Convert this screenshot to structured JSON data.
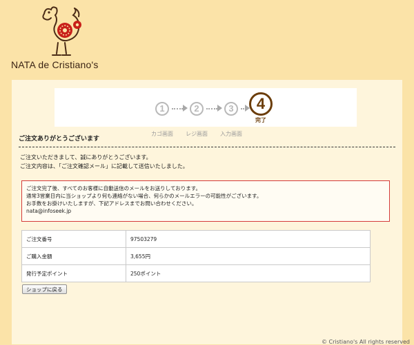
{
  "brand": {
    "name": "NATA de Cristiano's"
  },
  "steps": [
    {
      "num": "1",
      "label": "カゴ画面"
    },
    {
      "num": "2",
      "label": "レジ画面"
    },
    {
      "num": "3",
      "label": "入力画面"
    },
    {
      "num": "4",
      "label": "完了"
    }
  ],
  "heading": "ご注文ありがとうございます",
  "thanks": {
    "line1": "ご注文いただきまして、誠にありがとうございます。",
    "line2": "ご注文内容は、「ご注文確認メール」に記載して送信いたしました。"
  },
  "notice": {
    "line1": "ご注文完了後、すべてのお客様に自動送信のメールをお送りしております。",
    "line2": "通常3営業日内に当ショップより何も連絡がない場合、何らかのメールエラーの可能性がございます。",
    "line3": "お手数をお掛けいたしますが、下記アドレスまでお問い合わせください。",
    "email": "nata@infoseek.jp"
  },
  "order": [
    {
      "label": "ご注文番号",
      "value": "97503279"
    },
    {
      "label": "ご購入金額",
      "value": "3,655円"
    },
    {
      "label": "発行予定ポイント",
      "value": "250ポイント"
    }
  ],
  "back_button": "ショップに戻る",
  "copyright": "© Cristiano's All rights reserved"
}
